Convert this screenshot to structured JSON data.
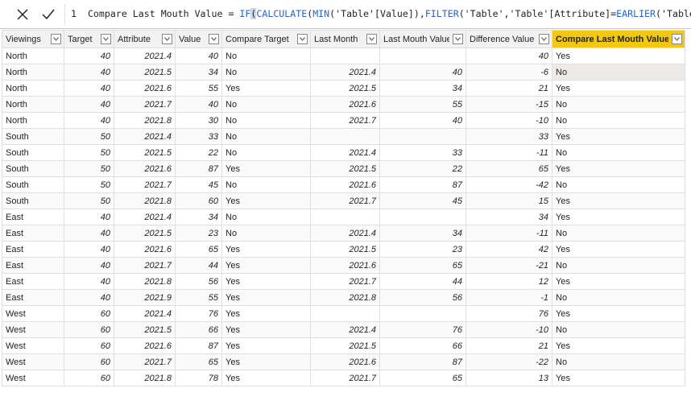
{
  "formula": {
    "line_no": "1",
    "prefix": "Compare Last Mouth Value = ",
    "fn_if": "IF",
    "paren_open": "(",
    "fn_calculate": "CALCULATE",
    "mid1": "(",
    "fn_min": "MIN",
    "mid2": "('Table'[Value]),",
    "fn_filter": "FILTER",
    "mid3": "('Table','Table'[Attribute]=",
    "fn_earlier": "EARLIER",
    "tail": "('Table'[Last"
  },
  "columns": [
    "Viewings",
    "Target",
    "Attribute",
    "Value",
    "Compare Target",
    "Last Month",
    "Last Mouth Value",
    "Difference Value",
    "Compare Last Mouth Value"
  ],
  "rows": [
    [
      "North",
      "40",
      "2021.4",
      "40",
      "No",
      "",
      "",
      "40",
      "Yes"
    ],
    [
      "North",
      "40",
      "2021.5",
      "34",
      "No",
      "2021.4",
      "40",
      "-6",
      "No"
    ],
    [
      "North",
      "40",
      "2021.6",
      "55",
      "Yes",
      "2021.5",
      "34",
      "21",
      "Yes"
    ],
    [
      "North",
      "40",
      "2021.7",
      "40",
      "No",
      "2021.6",
      "55",
      "-15",
      "No"
    ],
    [
      "North",
      "40",
      "2021.8",
      "30",
      "No",
      "2021.7",
      "40",
      "-10",
      "No"
    ],
    [
      "South",
      "50",
      "2021.4",
      "33",
      "No",
      "",
      "",
      "33",
      "Yes"
    ],
    [
      "South",
      "50",
      "2021.5",
      "22",
      "No",
      "2021.4",
      "33",
      "-11",
      "No"
    ],
    [
      "South",
      "50",
      "2021.6",
      "87",
      "Yes",
      "2021.5",
      "22",
      "65",
      "Yes"
    ],
    [
      "South",
      "50",
      "2021.7",
      "45",
      "No",
      "2021.6",
      "87",
      "-42",
      "No"
    ],
    [
      "South",
      "50",
      "2021.8",
      "60",
      "Yes",
      "2021.7",
      "45",
      "15",
      "Yes"
    ],
    [
      "East",
      "40",
      "2021.4",
      "34",
      "No",
      "",
      "",
      "34",
      "Yes"
    ],
    [
      "East",
      "40",
      "2021.5",
      "23",
      "No",
      "2021.4",
      "34",
      "-11",
      "No"
    ],
    [
      "East",
      "40",
      "2021.6",
      "65",
      "Yes",
      "2021.5",
      "23",
      "42",
      "Yes"
    ],
    [
      "East",
      "40",
      "2021.7",
      "44",
      "Yes",
      "2021.6",
      "65",
      "-21",
      "No"
    ],
    [
      "East",
      "40",
      "2021.8",
      "56",
      "Yes",
      "2021.7",
      "44",
      "12",
      "Yes"
    ],
    [
      "East",
      "40",
      "2021.9",
      "55",
      "Yes",
      "2021.8",
      "56",
      "-1",
      "No"
    ],
    [
      "West",
      "60",
      "2021.4",
      "76",
      "Yes",
      "",
      "",
      "76",
      "Yes"
    ],
    [
      "West",
      "60",
      "2021.5",
      "66",
      "Yes",
      "2021.4",
      "76",
      "-10",
      "No"
    ],
    [
      "West",
      "60",
      "2021.6",
      "87",
      "Yes",
      "2021.5",
      "66",
      "21",
      "Yes"
    ],
    [
      "West",
      "60",
      "2021.7",
      "65",
      "Yes",
      "2021.6",
      "87",
      "-22",
      "No"
    ],
    [
      "West",
      "60",
      "2021.8",
      "78",
      "Yes",
      "2021.7",
      "65",
      "13",
      "Yes"
    ]
  ],
  "numeric_columns": [
    1,
    2,
    3,
    5,
    6,
    7
  ],
  "active_column": 8,
  "selected_cell": [
    1,
    8
  ],
  "icons": {
    "cancel": "x-icon",
    "commit": "checkmark-icon",
    "filter": "dropdown-arrow-icon"
  }
}
